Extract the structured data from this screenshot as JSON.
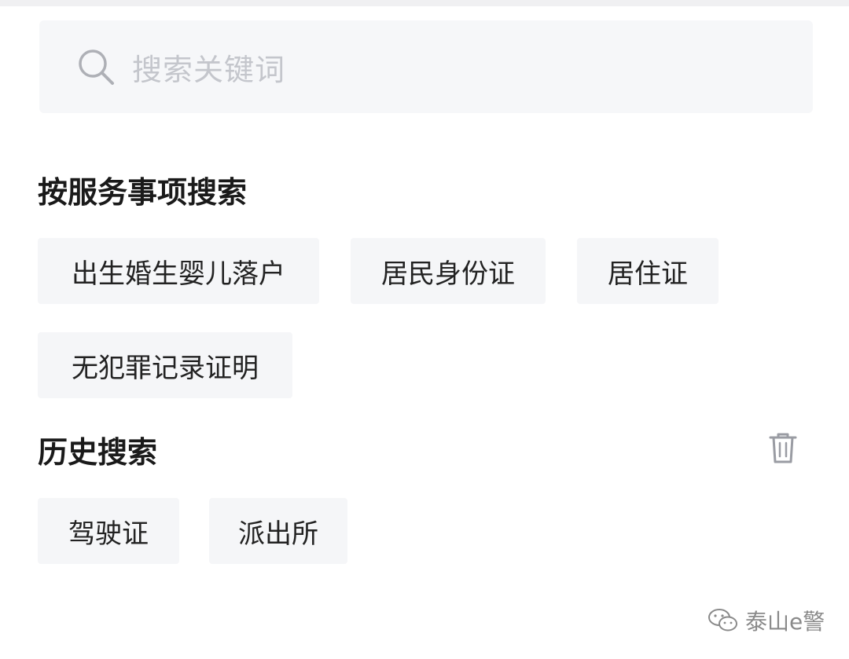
{
  "search": {
    "placeholder": "搜索关键词",
    "icon": "search-icon"
  },
  "services": {
    "title": "按服务事项搜索",
    "tags": [
      {
        "label": "出生婚生婴儿落户"
      },
      {
        "label": "居民身份证"
      },
      {
        "label": "居住证"
      },
      {
        "label": "无犯罪记录证明"
      }
    ]
  },
  "history": {
    "title": "历史搜索",
    "clear_icon": "trash-icon",
    "tags": [
      {
        "label": "驾驶证"
      },
      {
        "label": "派出所"
      }
    ]
  },
  "watermark": {
    "icon": "wechat-icon",
    "text": "泰山e警"
  },
  "colors": {
    "search_bg": "#f6f7f9",
    "tag_bg": "#f5f6f8",
    "placeholder": "#c4c6cc",
    "title": "#1a1a1a",
    "icon": "#9a9ca3"
  }
}
